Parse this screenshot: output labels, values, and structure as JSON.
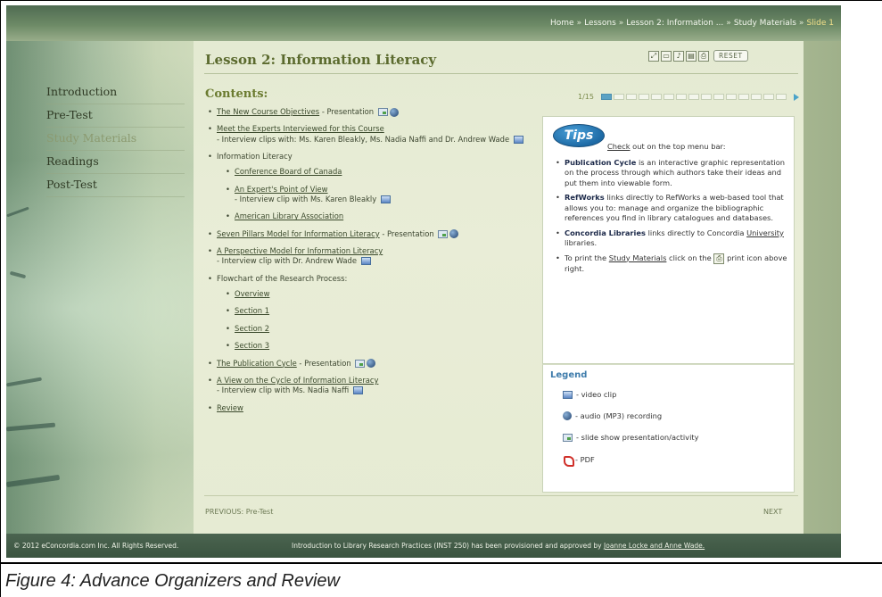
{
  "breadcrumb": {
    "items": [
      "Home",
      "Lessons",
      "Lesson 2: Information ...",
      "Study Materials"
    ],
    "current": "Slide 1",
    "separator": "»"
  },
  "lesson_title": "Lesson 2: Information Literacy",
  "toolbar": {
    "reset_label": "RESET",
    "icons": [
      "resize-icon",
      "window-icon",
      "flash-icon",
      "print-preview-icon",
      "print-icon"
    ]
  },
  "nav": {
    "items": [
      {
        "label": "Introduction",
        "active": false
      },
      {
        "label": "Pre-Test",
        "active": false
      },
      {
        "label": "Study Materials",
        "active": true
      },
      {
        "label": "Readings",
        "active": false
      },
      {
        "label": "Post-Test",
        "active": false
      }
    ]
  },
  "contents": {
    "heading": "Contents:",
    "progress_label": "1/15",
    "progress_value": 1,
    "progress_total": 15,
    "items": [
      {
        "link": "The New Course Objectives",
        "text": " - Presentation"
      },
      {
        "link": "Meet the Experts Interviewed for this Course",
        "text": "- Interview clips with: Ms. Karen Bleakly, Ms. Nadia Naffi and Dr. Andrew Wade"
      },
      {
        "label": "Information Literacy",
        "sub": [
          {
            "link": "Conference Board of Canada"
          },
          {
            "link": "An Expert's Point of View",
            "text": "- Interview clip with Ms. Karen Bleakly"
          },
          {
            "link": "American Library Association"
          }
        ]
      },
      {
        "link": "Seven Pillars Model for Information Literacy",
        "text": " - Presentation"
      },
      {
        "link": "A Perspective Model for Information Literacy",
        "text": "- Interview clip with Dr. Andrew Wade"
      },
      {
        "label": "Flowchart of the Research Process:",
        "sub": [
          {
            "link": "Overview"
          },
          {
            "link": "Section 1"
          },
          {
            "link": "Section 2"
          },
          {
            "link": "Section 3"
          }
        ]
      },
      {
        "link": "The Publication Cycle",
        "text": " - Presentation"
      },
      {
        "link": "A View on the Cycle of Information Literacy",
        "text": "- Interview clip with Ms. Nadia Naffi"
      },
      {
        "link": "Review"
      }
    ]
  },
  "tips": {
    "badge": "Tips",
    "intro_link": "Check",
    "intro_text": " out on the top menu bar:",
    "items": [
      {
        "bold": "Publication Cycle",
        "text": " is an interactive graphic representation on the process through which authors take their ideas and put them into viewable form."
      },
      {
        "bold": "RefWorks",
        "text": " links directly to RefWorks a web-based tool that allows you to: manage and organize the bibliographic references you find in library catalogues and databases."
      },
      {
        "bold": "Concordia Libraries",
        "text": " links directly to Concordia ",
        "link": "University",
        "text_after": " libraries."
      },
      {
        "text": "To print the ",
        "link": "Study Materials",
        "text_after": " click on the ",
        "text_end": " print icon above right."
      }
    ]
  },
  "legend": {
    "title": "Legend",
    "items": [
      {
        "icon": "video-icon",
        "label": "- video clip"
      },
      {
        "icon": "audio-icon",
        "label": "- audio (MP3) recording"
      },
      {
        "icon": "slideshow-icon",
        "label": "- slide show presentation/activity"
      },
      {
        "icon": "pdf-icon",
        "label": "- PDF"
      }
    ]
  },
  "pager": {
    "previous": "PREVIOUS: Pre-Test",
    "next": "NEXT"
  },
  "footer": {
    "copyright": "© 2012 eConcordia.com Inc. All Rights Reserved.",
    "note": "Introduction to Library Research Practices (INST 250) has been provisioned and approved by ",
    "note_link": "Joanne Locke and Anne Wade."
  },
  "figure_caption": "Figure 4: Advance Organizers and Review",
  "colors": {
    "accent_blue": "#3f7cab",
    "title_olive": "#5b6a2e",
    "footer_green": "#3b5440"
  }
}
